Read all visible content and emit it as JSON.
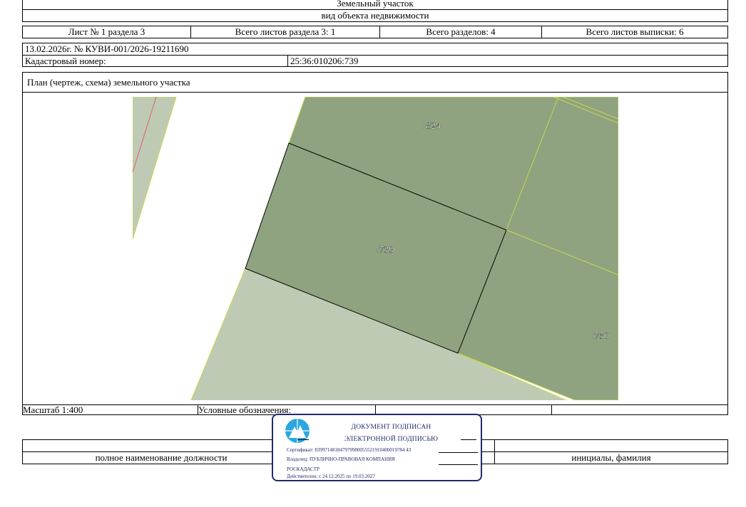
{
  "header": {
    "object_type_value": "Земельный участок",
    "object_type_caption": "вид объекта недвижимости"
  },
  "sheet_info": {
    "sheet": "Лист № 1 раздела 3",
    "total_sheets_section": "Всего листов раздела 3: 1",
    "total_sections": "Всего разделов: 4",
    "total_sheets_extract": "Всего листов выписки: 6"
  },
  "document": {
    "date_number": "13.02.2026г. № КУВИ-001/2026-19211690",
    "cadastral_label": "Кадастровый номер:",
    "cadastral_number": "25:36:010206:739"
  },
  "plan": {
    "title": "План (чертеж, схема) земельного участка",
    "parcels": [
      {
        "label": ":824"
      },
      {
        "label": ":739"
      },
      {
        "label": ":750"
      }
    ]
  },
  "footer": {
    "scale": "Масштаб 1:400",
    "legend": "Условные обозначения:",
    "position_caption": "полное наименование должности",
    "initials_caption": "инициалы, фамилия"
  },
  "stamp": {
    "line1": "ДОКУМЕНТ ПОДПИСАН",
    "line2": "ЭЛЕКТРОННОЙ ПОДПИСЬЮ",
    "certificate": "Сертификат: 839971481847979980055521910400019784 43",
    "owner_line1": "Владелец: ПУБЛИЧНО-ПРАВОВАЯ КОМПАНИЯ",
    "owner_line2": "РОСКАДАСТР",
    "valid": "Действителен: с 24.12.2025 по 19.03.2027",
    "logo_icon": "roskadastr-logo-icon",
    "border_color": "#1f2a6b"
  }
}
